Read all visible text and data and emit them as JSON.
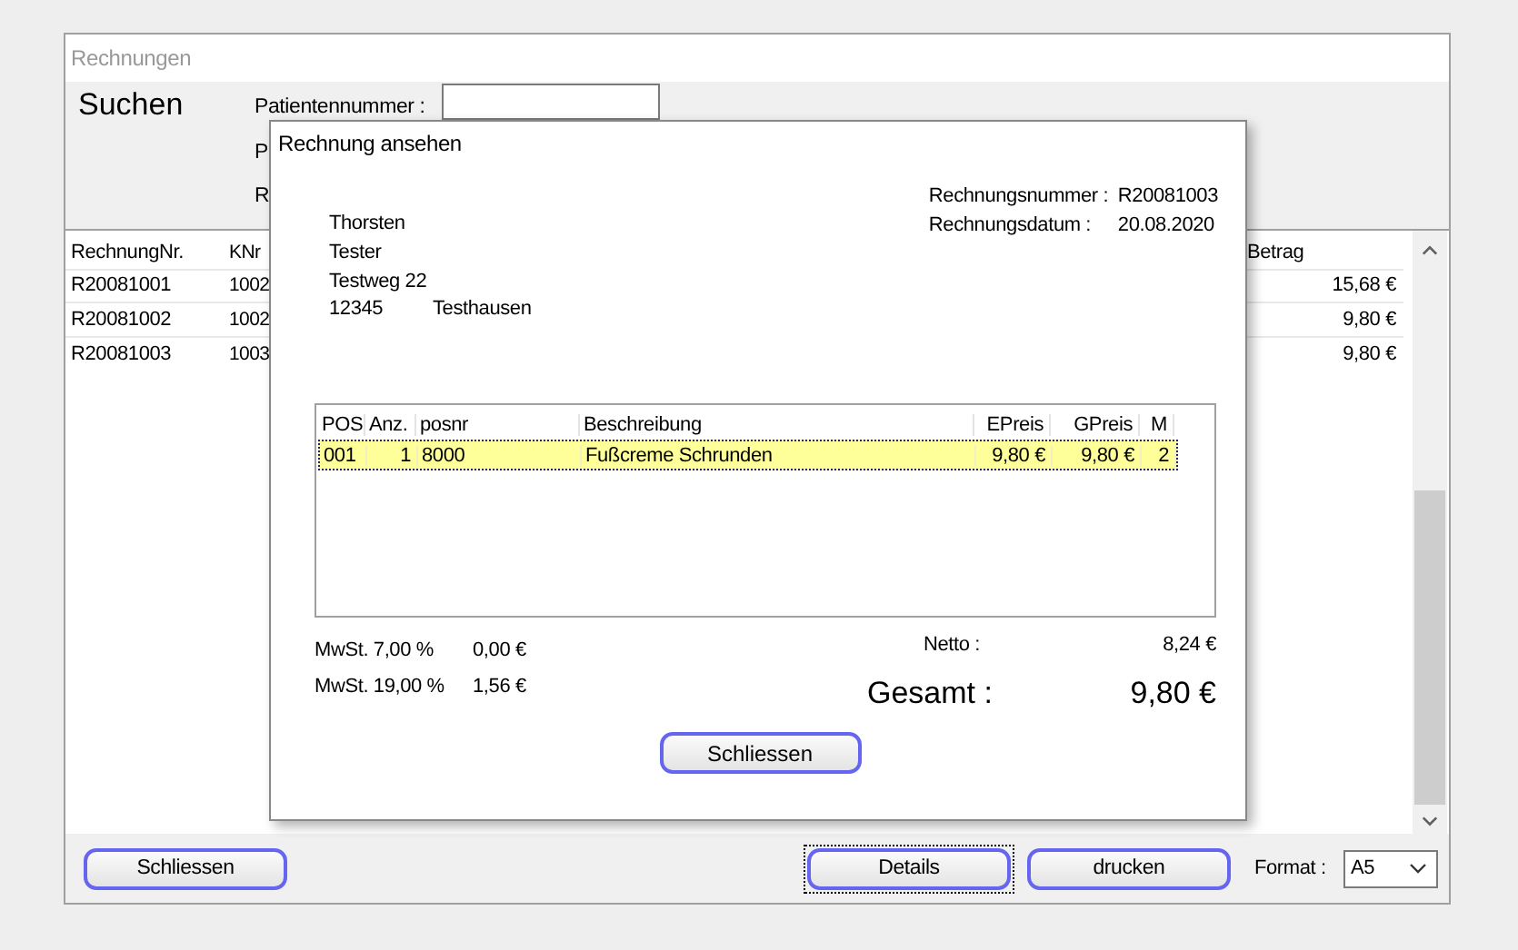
{
  "window": {
    "title": "Rechnungen"
  },
  "search": {
    "heading": "Suchen",
    "fields": [
      {
        "label": "Patientennummer :",
        "kind": "text_input"
      },
      {
        "label": "P",
        "kind": "label"
      },
      {
        "label": "R",
        "kind": "label"
      }
    ]
  },
  "invoices": {
    "columns": [
      "RechnungNr.",
      "KNr",
      "Betrag"
    ],
    "rows": [
      [
        "R20081001",
        "1002",
        "15,68 €"
      ],
      [
        "R20081002",
        "1002",
        "9,80 €"
      ],
      [
        "R20081003",
        "1003",
        "9,80 €"
      ]
    ]
  },
  "dialog": {
    "title": "Rechnung ansehen",
    "address": {
      "first_name": "Thorsten",
      "last_name": "Tester",
      "street": "Testweg 22",
      "zip": "12345",
      "city": "Testhausen"
    },
    "info": [
      {
        "label": "Rechnungsnummer :",
        "value": "R20081003"
      },
      {
        "label": "Rechnungsdatum :",
        "value": "20.08.2020"
      }
    ],
    "items": {
      "columns": [
        "POS",
        "Anz.",
        "posnr",
        "Beschreibung",
        "EPreis",
        "GPreis",
        "M"
      ],
      "rows": [
        {
          "cells": [
            "001",
            "1",
            "8000",
            "Fußcreme Schrunden",
            "9,80 €",
            "9,80 €",
            "2"
          ],
          "selected": true
        }
      ]
    },
    "vat": [
      {
        "label": "MwSt. 7,00 %",
        "value": "0,00 €"
      },
      {
        "label": "MwSt. 19,00 %",
        "value": "1,56 €"
      }
    ],
    "netto": {
      "label": "Netto :",
      "value": "8,24 €"
    },
    "gesamt": {
      "label": "Gesamt :",
      "value": "9,80 €"
    },
    "close_button": "Schliessen"
  },
  "buttons": [
    {
      "label": "Schliessen",
      "focused": false
    },
    {
      "label": "Details",
      "focused": true
    },
    {
      "label": "drucken",
      "focused": false
    }
  ],
  "format": {
    "label": "Format :",
    "value": "A5"
  }
}
